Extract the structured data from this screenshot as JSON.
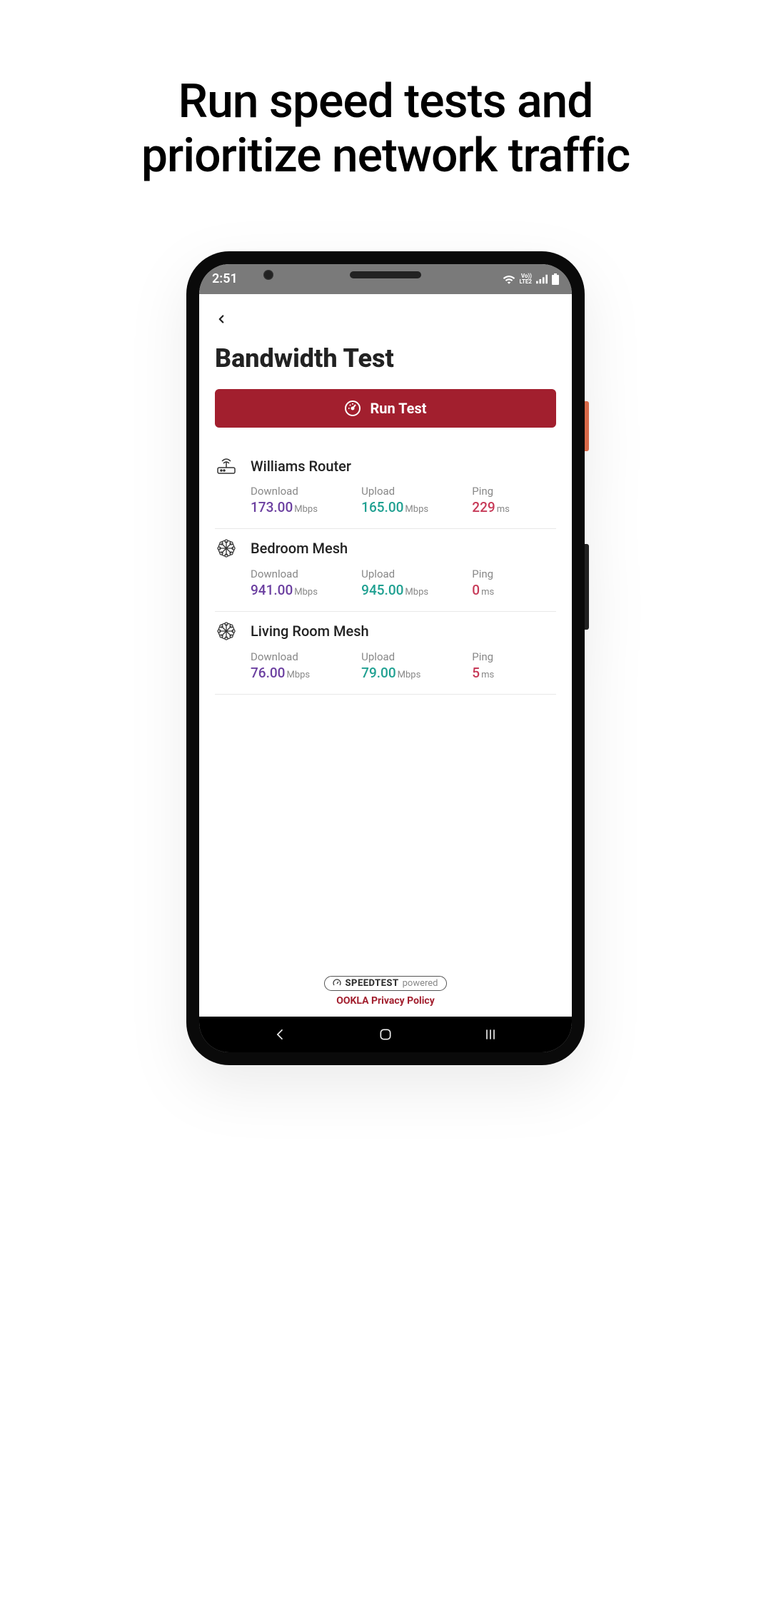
{
  "promo": {
    "title_line1": "Run speed tests and",
    "title_line2": "prioritize network traffic"
  },
  "status": {
    "time": "2:51",
    "lte": "LTE2",
    "vo": "Vo))"
  },
  "page": {
    "title": "Bandwidth Test",
    "run_button": "Run Test"
  },
  "labels": {
    "download": "Download",
    "upload": "Upload",
    "ping": "Ping",
    "mbps": "Mbps",
    "ms": "ms"
  },
  "devices": [
    {
      "name": "Williams Router",
      "icon": "router",
      "download": "173.00",
      "upload": "165.00",
      "ping": "229"
    },
    {
      "name": "Bedroom Mesh",
      "icon": "mesh",
      "download": "941.00",
      "upload": "945.00",
      "ping": "0"
    },
    {
      "name": "Living Room Mesh",
      "icon": "mesh",
      "download": "76.00",
      "upload": "79.00",
      "ping": "5"
    }
  ],
  "footer": {
    "speedtest_brand": "SPEEDTEST",
    "speedtest_suffix": "powered",
    "privacy": "OOKLA Privacy Policy"
  }
}
